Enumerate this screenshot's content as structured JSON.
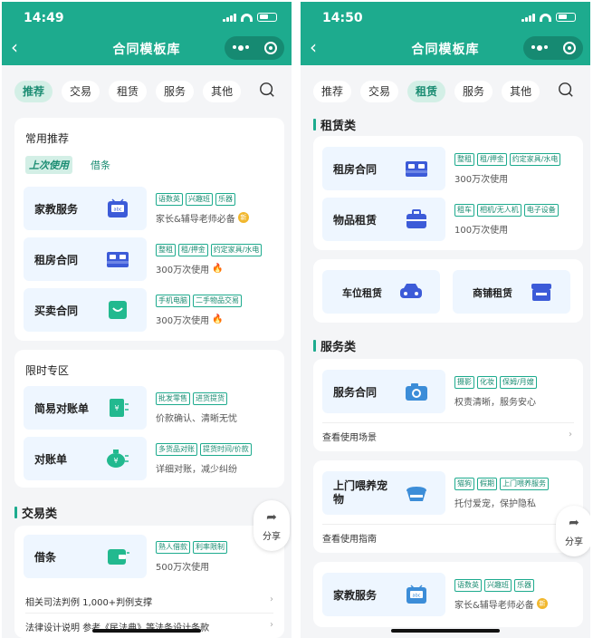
{
  "left": {
    "status_time": "14:49",
    "nav_title": "合同模板库",
    "tabs": [
      "推荐",
      "交易",
      "租赁",
      "服务",
      "其他"
    ],
    "active_tab": 0,
    "common": {
      "title": "常用推荐",
      "sub_active": "上次使用",
      "sub_other": "借条",
      "items": [
        {
          "name": "家教服务",
          "tags": [
            "语数英",
            "兴趣班",
            "乐器"
          ],
          "desc": "家长&辅导老师必备",
          "badge": "新"
        },
        {
          "name": "租房合同",
          "tags": [
            "整租",
            "租/押金",
            "约定家具/水电"
          ],
          "desc": "300万次使用",
          "badge": "fire"
        },
        {
          "name": "买卖合同",
          "tags": [
            "手机电脑",
            "二手物品交易"
          ],
          "desc": "300万次使用",
          "badge": "fire"
        }
      ]
    },
    "limited": {
      "title": "限时专区",
      "items": [
        {
          "name": "简易对账单",
          "tags": [
            "批发零售",
            "进货提货"
          ],
          "desc": "价款确认、清晰无忧"
        },
        {
          "name": "对账单",
          "tags": [
            "多货品对账",
            "提货时间/价款"
          ],
          "desc": "详细对账，减少纠纷"
        }
      ]
    },
    "trade": {
      "title": "交易类",
      "item": {
        "name": "借条",
        "tags": [
          "熟人借款",
          "利率限制"
        ],
        "desc": "500万次使用"
      },
      "rows": [
        {
          "label": "相关司法判例 1,000+判例支撑"
        },
        {
          "label": "法律设计说明 参考《民法典》等法条设计条款"
        }
      ]
    },
    "share": "分享"
  },
  "right": {
    "status_time": "14:50",
    "nav_title": "合同模板库",
    "tabs": [
      "推荐",
      "交易",
      "租赁",
      "服务",
      "其他"
    ],
    "active_tab": 2,
    "rent": {
      "title": "租赁类",
      "items": [
        {
          "name": "租房合同",
          "tags": [
            "整租",
            "租/押金",
            "约定家具/水电"
          ],
          "desc": "300万次使用"
        },
        {
          "name": "物品租赁",
          "tags": [
            "租车",
            "相机/无人机",
            "电子设备"
          ],
          "desc": "100万次使用"
        }
      ],
      "pair": [
        "车位租赁",
        "商铺租赁"
      ]
    },
    "service": {
      "title": "服务类",
      "items": [
        {
          "name": "服务合同",
          "tags": [
            "摄影",
            "化妆",
            "保姆/月嫂"
          ],
          "desc": "权责清晰，服务安心",
          "link": "查看使用场景"
        },
        {
          "name": "上门喂养宠物",
          "tags": [
            "猫狗",
            "假期",
            "上门喂养服务"
          ],
          "desc": "托付爱宠，保护隐私",
          "link": "查看使用指南"
        },
        {
          "name": "家教服务",
          "tags": [
            "语数英",
            "兴趣班",
            "乐器"
          ],
          "desc": "家长&辅导老师必备",
          "badge": "新"
        }
      ]
    },
    "share": "分享"
  },
  "colors": {
    "brand": "#1dab8e",
    "brand_dark": "#168a72",
    "tag": "#1a8c72",
    "icon_blue": "#3c5bd8",
    "icon_green": "#22b98f"
  }
}
